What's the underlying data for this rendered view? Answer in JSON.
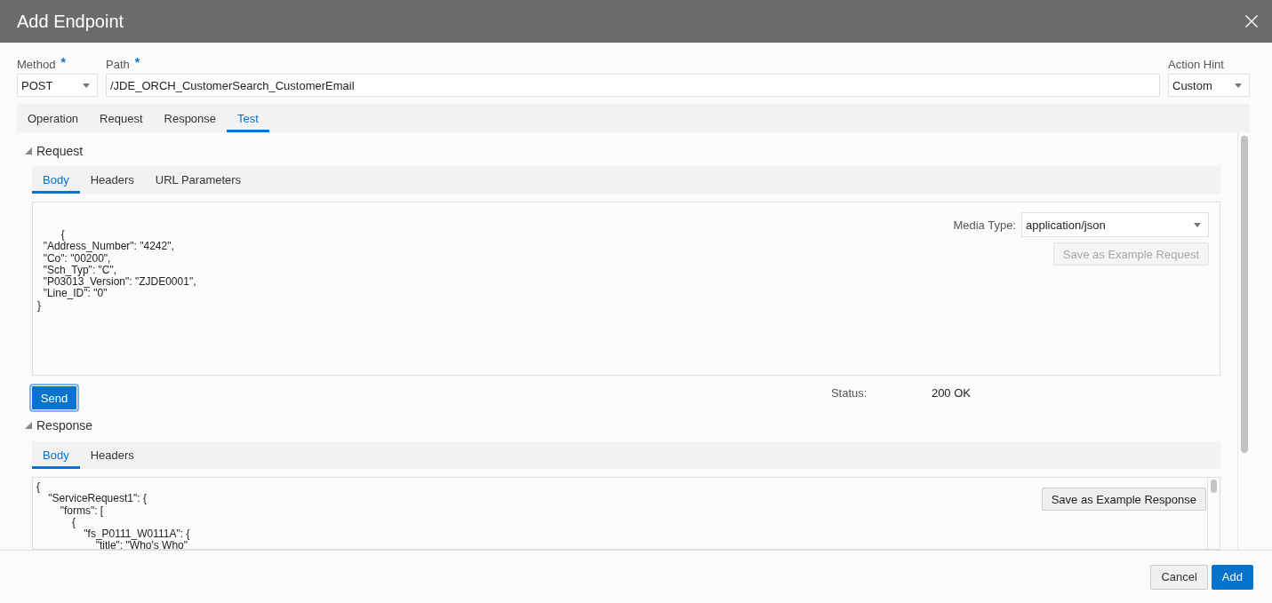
{
  "window": {
    "title": "Add Endpoint"
  },
  "fields": [
    {
      "kind": "select",
      "label": "Method",
      "required_mark": "*",
      "value": "POST"
    },
    {
      "kind": "text",
      "label": "Path",
      "required_mark": "*",
      "value": "/JDE_ORCH_CustomerSearch_CustomerEmail"
    },
    {
      "kind": "select",
      "label": "Action Hint",
      "value": "Custom"
    }
  ],
  "tabs": [
    {
      "label": "Operation",
      "selected": false
    },
    {
      "label": "Request",
      "selected": false
    },
    {
      "label": "Response",
      "selected": false
    },
    {
      "label": "Test",
      "selected": true
    }
  ],
  "request": {
    "title": "Request",
    "expanded": true,
    "tabs": [
      {
        "label": "Body",
        "selected": true
      },
      {
        "label": "Headers",
        "selected": false
      },
      {
        "label": "URL Parameters",
        "selected": false
      }
    ],
    "body": "        {\n  \"Address_Number\": \"4242\",\n  \"Co\": \"00200\",\n  \"Sch_Typ\": \"C\",\n  \"P03013_Version\": \"ZJDE0001\",\n  \"Line_ID\": \"0\"\n}",
    "media_type": {
      "label": "Media Type:",
      "value": "application/json"
    },
    "save_button": {
      "label": "Save as Example Request",
      "disabled": true
    }
  },
  "send_button": {
    "label": "Send",
    "focused": true
  },
  "status": {
    "label": "Status:",
    "value": "200 OK"
  },
  "response": {
    "title": "Response",
    "expanded": true,
    "tabs": [
      {
        "label": "Body",
        "selected": true
      },
      {
        "label": "Headers",
        "selected": false
      }
    ],
    "body": "{\n    \"ServiceRequest1\": {\n        \"forms\": [\n            {\n                \"fs_P0111_W0111A\": {\n                    \"title\": \"Who's Who\"",
    "save_button": {
      "label": "Save as Example Response",
      "disabled": false
    }
  },
  "footer_buttons": [
    {
      "label": "Cancel",
      "kind": "secondary"
    },
    {
      "label": "Add",
      "kind": "primary"
    }
  ]
}
